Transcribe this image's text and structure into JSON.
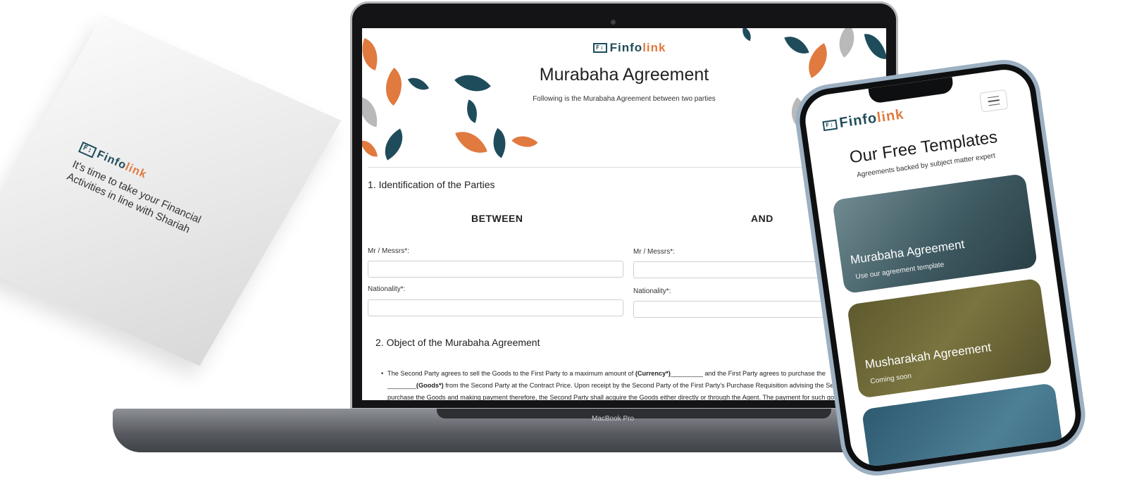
{
  "paper": {
    "brand_mark": "F:",
    "brand_finfo": "Finfo",
    "brand_link": "link",
    "tagline": "It's time to take your Financial Activities in line with Shariah"
  },
  "laptop": {
    "model_label": "MacBook Pro",
    "screen": {
      "logo_mark": "F:",
      "logo_finfo": "Finfo",
      "logo_link": "link",
      "title": "Murabaha Agreement",
      "subtitle": "Following is the Murabaha Agreement between two parties",
      "section1_title": "1. Identification of the Parties",
      "between_label": "BETWEEN",
      "and_label": "AND",
      "party1_name_label": "Mr / Messrs*:",
      "party1_nationality_label": "Nationality*:",
      "party2_name_label": "Mr / Messrs*:",
      "party2_nationality_label": "Nationality*:",
      "section2_title": "2. Object of the Murabaha Agreement",
      "para_part1": "The Second Party agrees to sell the Goods to the First Party to a maximum amount of ",
      "para_bold1": "(Currency*)",
      "para_part2": "_________ and the First Party agrees to purchase the ________",
      "para_bold2": "(Goods*)",
      "para_part3": " from the Second Party at the Contract Price. Upon receipt by the Second Party of the First Party's Purchase Requisition advising the Second Party to purchase the Goods and making payment therefore, the Second Party shall acquire the Goods either directly or through the Agent. The payment for such goods shall be made by the Second Party on submission"
    }
  },
  "phone": {
    "logo_mark": "F:",
    "logo_finfo": "Finfo",
    "logo_link": "link",
    "menu_icon": "hamburger-icon",
    "title": "Our Free Templates",
    "subtitle": "Agreements backed by subject matter expert",
    "cards": [
      {
        "title": "Murabaha Agreement",
        "subtitle": "Use our agreement template"
      },
      {
        "title": "Musharakah Agreement",
        "subtitle": "Coming soon"
      },
      {
        "title": "",
        "subtitle": ""
      }
    ]
  },
  "colors": {
    "brand_teal": "#1f4c5b",
    "brand_orange": "#e07a3f",
    "leaf_grey": "#b9b9b9"
  }
}
